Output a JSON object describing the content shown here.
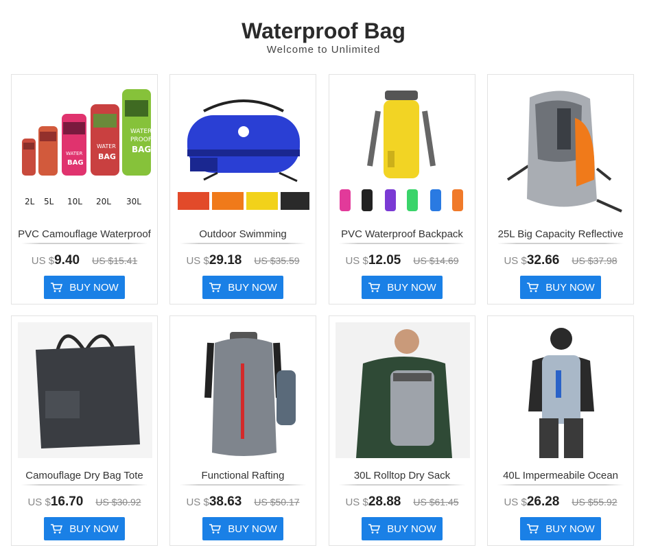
{
  "header": {
    "title": "Waterproof Bag",
    "subtitle": "Welcome to Unlimited"
  },
  "buy_label": "BUY NOW",
  "currency": "US $",
  "products": [
    {
      "name": "PVC Camouflage Waterproof",
      "price": "9.40",
      "old_price": "US $15.41",
      "image": "camouflage-dry-bags"
    },
    {
      "name": "Outdoor Swimming",
      "price": "29.18",
      "old_price": "US $35.59",
      "image": "blue-duffel-bag"
    },
    {
      "name": "PVC Waterproof Backpack",
      "price": "12.05",
      "old_price": "US $14.69",
      "image": "yellow-dry-backpack"
    },
    {
      "name": "25L Big Capacity Reflective",
      "price": "32.66",
      "old_price": "US $37.98",
      "image": "gray-orange-backpack"
    },
    {
      "name": "Camouflage Dry Bag Tote",
      "price": "16.70",
      "old_price": "US $30.92",
      "image": "black-tote-bag"
    },
    {
      "name": "Functional Rafting",
      "price": "38.63",
      "old_price": "US $50.17",
      "image": "gray-rafting-backpack"
    },
    {
      "name": "30L Rolltop Dry Sack",
      "price": "28.88",
      "old_price": "US $61.45",
      "image": "man-with-rolltop-sack"
    },
    {
      "name": "40L Impermeabile Ocean",
      "price": "26.28",
      "old_price": "US $55.92",
      "image": "man-with-ocean-pack"
    }
  ],
  "colors": {
    "button": "#1a80e6",
    "card_border": "#e2e2e2"
  }
}
